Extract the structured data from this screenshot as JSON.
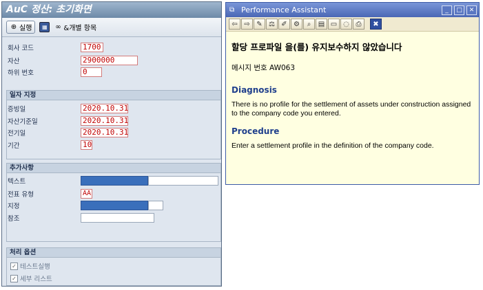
{
  "sap": {
    "title": "AuC 정산: 초기화면",
    "toolbar": {
      "execute_label": "실행",
      "items_label": "&개별 항목"
    },
    "fields": {
      "company_code_label": "회사 코드",
      "company_code_value": "1700",
      "asset_label": "자산",
      "asset_value": "2900000",
      "sub_number_label": "하위 번호",
      "sub_number_value": "0"
    },
    "dates": {
      "group_label": "일자 지정",
      "document_date_label": "증빙일",
      "document_date_value": "2020.10.31",
      "asset_value_date_label": "자산기준일",
      "asset_value_date_value": "2020.10.31",
      "posting_date_label": "전기일",
      "posting_date_value": "2020.10.31",
      "period_label": "기간",
      "period_value": "10"
    },
    "additional": {
      "group_label": "추가사항",
      "text_label": "텍스트",
      "doc_type_label": "전표 유형",
      "doc_type_value": "AA",
      "assignment_label": "지정",
      "reference_label": "참조"
    },
    "processing": {
      "group_label": "처리 옵션",
      "test_run_label": "테스트실행",
      "detail_list_label": "세부 리스트"
    }
  },
  "pa": {
    "title": "Performance Assistant",
    "heading": "할당 프로파일 을(를) 유지보수하지 않았습니다",
    "message_no": "메시지 번호 AW063",
    "diagnosis_title": "Diagnosis",
    "diagnosis_text": "There is no profile for the settlement of assets under construction assigned to the company code you entered.",
    "procedure_title": "Procedure",
    "procedure_text": "Enter a settlement profile in the definition of the company code."
  },
  "colors": {
    "sap_bg": "#dfe6ef",
    "pa_bg": "#ffffe1",
    "pa_title": "#4a67b5",
    "required_text": "#c00000",
    "fill_blue": "#3a6fbb"
  }
}
